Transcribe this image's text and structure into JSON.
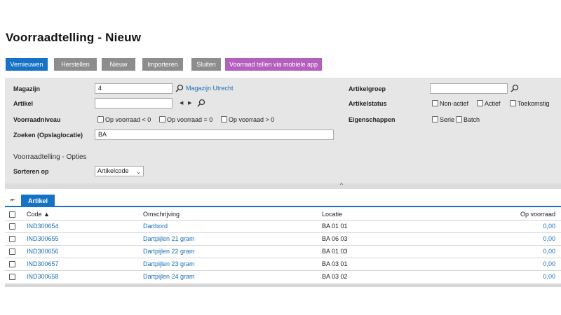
{
  "page": {
    "title": "Voorraadtelling - Nieuw"
  },
  "toolbar": {
    "refresh": "Vernieuwen",
    "reset": "Herstellen",
    "new": "Nieuw",
    "import": "Importeren",
    "close": "Sluiten",
    "mobile": "Voorraad tellen via mobiele app",
    "colors": {
      "primary": "#1672c5",
      "grey": "#8d8d8d",
      "purple": "#b45fbd"
    }
  },
  "filters": {
    "warehouse": {
      "label": "Magazijn",
      "value": "4",
      "link": "Magazijn Utrecht"
    },
    "article": {
      "label": "Artikel",
      "value": ""
    },
    "stock_level": {
      "label": "Voorraadniveau",
      "options": [
        "Op voorraad < 0",
        "Op voorraad = 0",
        "Op voorraad > 0"
      ]
    },
    "search": {
      "label": "Zoeken (Opslaglocatie)",
      "value": "BA"
    },
    "article_group": {
      "label": "Artikelgroep",
      "value": ""
    },
    "article_status": {
      "label": "Artikelstatus",
      "options": [
        "Non-actief",
        "Actief",
        "Toekomstig"
      ]
    },
    "properties": {
      "label": "Eigenschappen",
      "options": [
        "Serie",
        "Batch"
      ]
    }
  },
  "options": {
    "title": "Voorraadtelling - Opties",
    "sort_label": "Sorteren op",
    "sort_value": "Artikelcode"
  },
  "tabs": {
    "active": "Artikel"
  },
  "table": {
    "columns": {
      "code": "Code ▲",
      "description": "Omschrijving",
      "location": "Locatie",
      "stock": "Op voorraad"
    },
    "rows": [
      {
        "code": "IND300654",
        "description": "Dartbord",
        "location": "BA 01 01",
        "stock": "0,00"
      },
      {
        "code": "IND300655",
        "description": "Dartpijlen 21 gram",
        "location": "BA 06 03",
        "stock": "0,00"
      },
      {
        "code": "IND300656",
        "description": "Dartpijlen 22 gram",
        "location": "BA 01 03",
        "stock": "0,00"
      },
      {
        "code": "IND300657",
        "description": "Dartpijlen 23 gram",
        "location": "BA 03 01",
        "stock": "0,00"
      },
      {
        "code": "IND300658",
        "description": "Dartpijlen 24 gram",
        "location": "BA 03 02",
        "stock": "0,00"
      }
    ]
  }
}
